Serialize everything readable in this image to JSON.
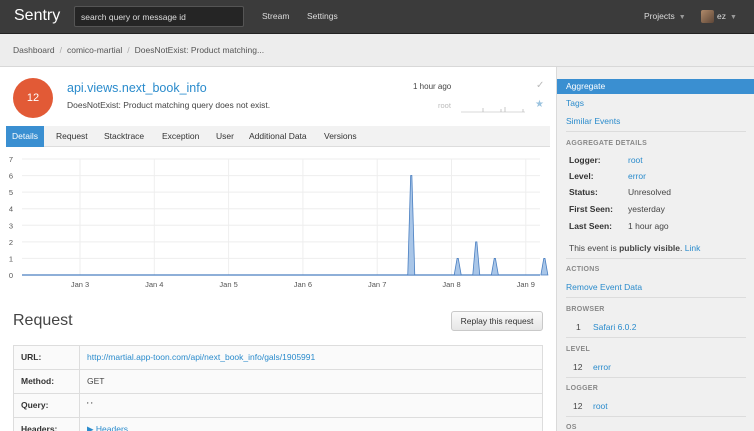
{
  "navbar": {
    "brand": "Sentry",
    "search_placeholder": "search query or message id",
    "links": [
      "Stream",
      "Settings"
    ],
    "projects_label": "Projects",
    "user_label": "ez"
  },
  "breadcrumb": [
    "Dashboard",
    "comico-martial",
    "DoesNotExist: Product matching..."
  ],
  "event": {
    "count": "12",
    "title": "api.views.next_book_info",
    "message": "DoesNotExist: Product matching query does not exist.",
    "time_ago": "1 hour ago",
    "logger": "root"
  },
  "tabs": [
    "Details",
    "Request",
    "Stacktrace",
    "Exception",
    "User",
    "Additional Data",
    "Versions"
  ],
  "active_tab": "Details",
  "chart_data": {
    "type": "area",
    "y_ticks": [
      "0",
      "1",
      "2",
      "3",
      "4",
      "5",
      "6",
      "7"
    ],
    "x_ticks": [
      "Jan 3",
      "Jan 4",
      "Jan 5",
      "Jan 6",
      "Jan 7",
      "Jan 8",
      "Jan 9"
    ],
    "ylim": [
      0,
      7
    ],
    "spikes": [
      {
        "x": "Jan 7 ~11:00",
        "value": 6
      },
      {
        "x": "Jan 8 ~02:00",
        "value": 1
      },
      {
        "x": "Jan 8 ~08:00",
        "value": 2
      },
      {
        "x": "Jan 8 ~14:00",
        "value": 1
      },
      {
        "x": "Jan 9 ~06:00",
        "value": 1
      }
    ],
    "grid": true,
    "fill_color": "#a9c6e8",
    "line_color": "#4a7fc1"
  },
  "request": {
    "title": "Request",
    "replay_label": "Replay this request",
    "rows": [
      {
        "key": "URL:",
        "value": "http://martial.app-toon.com/api/next_book_info/gals/1905991",
        "link": true
      },
      {
        "key": "Method:",
        "value": "GET",
        "link": false
      },
      {
        "key": "Query:",
        "value": "' '",
        "link": false
      },
      {
        "key": "Headers:",
        "value": "▶ Headers",
        "link": true
      }
    ]
  },
  "sidebar": {
    "nav": [
      "Aggregate",
      "Tags",
      "Similar Events"
    ],
    "aggregate_heading": "AGGREGATE DETAILS",
    "details": [
      {
        "key": "Logger:",
        "value": "root",
        "link": true
      },
      {
        "key": "Level:",
        "value": "error",
        "link": true
      },
      {
        "key": "Status:",
        "value": "Unresolved",
        "link": false
      },
      {
        "key": "First Seen:",
        "value": "yesterday",
        "link": false
      },
      {
        "key": "Last Seen:",
        "value": "1 hour ago",
        "link": false
      }
    ],
    "visibility_prefix": "This event is ",
    "visibility_bold": "publicly visible",
    "visibility_suffix": ".",
    "visibility_link": "Link",
    "actions_heading": "ACTIONS",
    "remove_label": "Remove Event Data",
    "browser_heading": "BROWSER",
    "browser": {
      "count": "1",
      "value": "Safari 6.0.2"
    },
    "level_heading": "LEVEL",
    "level": {
      "count": "12",
      "value": "error"
    },
    "logger_heading": "LOGGER",
    "logger": {
      "count": "12",
      "value": "root"
    },
    "os_heading": "OS"
  },
  "colors": {
    "navbar": "#3b3b3b",
    "accent": "#3a8fd1",
    "badge": "#e25a36",
    "link": "#2a8bcc"
  }
}
